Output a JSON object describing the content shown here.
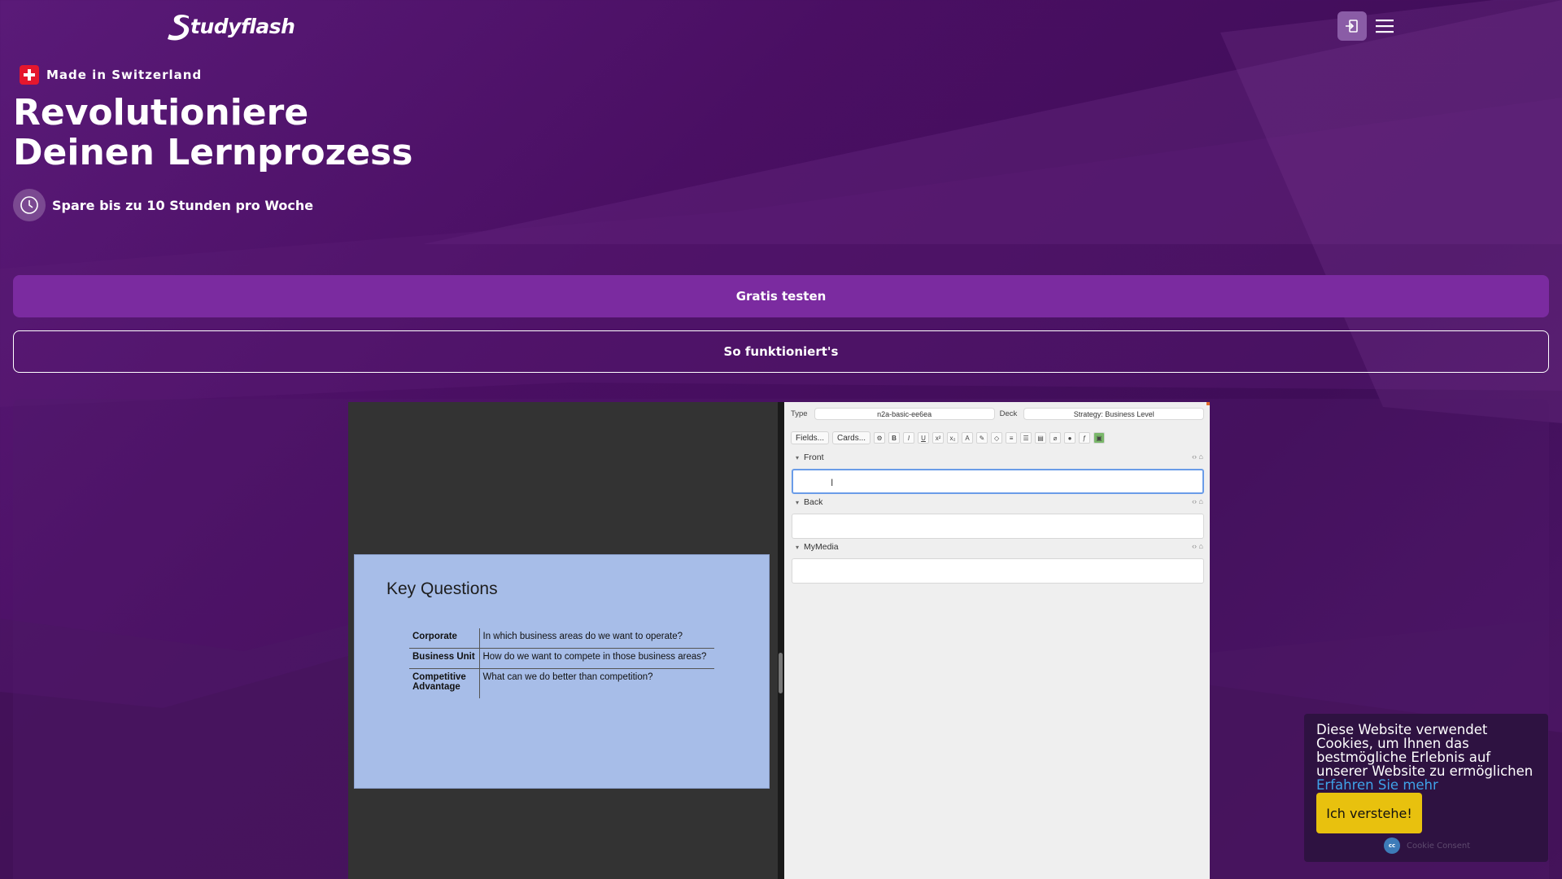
{
  "header": {
    "logo_text": "tudyflash",
    "login_icon": "login-icon",
    "menu_icon": "hamburger-menu-icon"
  },
  "hero": {
    "badge_text": "Made in Switzerland",
    "title_line1": "Revolutioniere",
    "title_line2": "Deinen Lernprozess",
    "save_text": "Spare bis zu 10 Stunden pro Woche",
    "cta_primary": "Gratis testen",
    "cta_secondary": "So funktioniert's"
  },
  "video": {
    "slide": {
      "title": "Key Questions",
      "rows": [
        {
          "key": "Corporate",
          "value": "In which business areas do we want to operate?"
        },
        {
          "key": "Business Unit",
          "value": "How do we want to compete in those business areas?"
        },
        {
          "key": "Competitive Advantage",
          "value": "What can we do better than competition?"
        }
      ]
    },
    "editor": {
      "type_label": "Type",
      "type_value": "n2a-basic-ee6ea",
      "deck_label": "Deck",
      "deck_value": "Strategy: Business Level",
      "fields_button": "Fields...",
      "cards_button": "Cards...",
      "front_label": "Front",
      "back_label": "Back",
      "media_label": "MyMedia"
    }
  },
  "cookie": {
    "text": "Diese Website verwendet Cookies, um Ihnen das bestmögliche Erlebnis auf unserer Website zu ermöglichen",
    "link_text": "Erfahren Sie mehr",
    "button_label": "Ich verstehe!",
    "brand_text": "Cookie Consent"
  },
  "colors": {
    "background": "#4a0f63",
    "primary_button": "#7b2ba0",
    "cookie_button": "#e8c10e",
    "cookie_link": "#3fa2e8",
    "swiss_red": "#e5172d"
  }
}
